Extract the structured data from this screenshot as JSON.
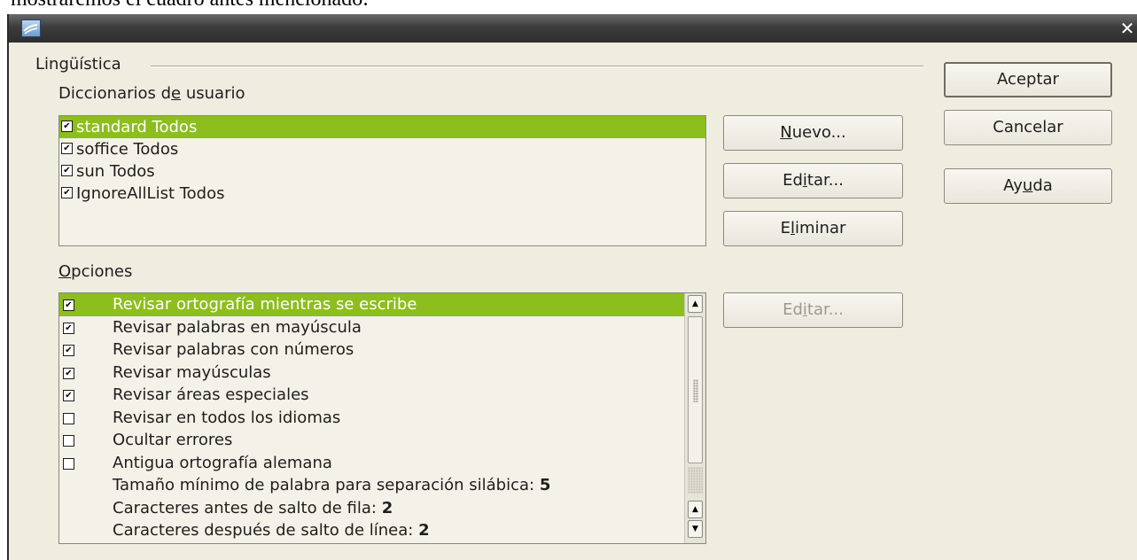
{
  "caption_above": "mostraremos el cuadro antes mencionado:",
  "window": {
    "title": ""
  },
  "section": {
    "title": "Lingüística"
  },
  "dictionaries": {
    "label": "Diccionarios de usuario",
    "items": [
      {
        "label": "standard Todos",
        "checked": true,
        "selected": true
      },
      {
        "label": "soffice Todos",
        "checked": true,
        "selected": false
      },
      {
        "label": "sun Todos",
        "checked": true,
        "selected": false
      },
      {
        "label": "IgnoreAllList Todos",
        "checked": true,
        "selected": false
      }
    ],
    "buttons": {
      "new": "Nuevo...",
      "edit": "Editar...",
      "delete": "Eliminar"
    }
  },
  "options": {
    "label": "Opciones",
    "edit_button": "Editar...",
    "items": [
      {
        "label": "Revisar ortografía mientras se escribe",
        "checked": true,
        "selected": true
      },
      {
        "label": "Revisar palabras en mayúscula",
        "checked": true
      },
      {
        "label": "Revisar palabras con números",
        "checked": true
      },
      {
        "label": "Revisar mayúsculas",
        "checked": true
      },
      {
        "label": "Revisar áreas especiales",
        "checked": true
      },
      {
        "label": "Revisar en todos los idiomas",
        "checked": false
      },
      {
        "label": "Ocultar errores",
        "checked": false
      },
      {
        "label": "Antigua ortografía alemana",
        "checked": false
      },
      {
        "label": "Tamaño mínimo de palabra para separación silábica:",
        "value": "5"
      },
      {
        "label": "Caracteres antes de salto de fila:",
        "value": "2"
      },
      {
        "label": "Caracteres después de salto de línea:",
        "value": "2"
      }
    ]
  },
  "dialog_buttons": {
    "ok": "Aceptar",
    "cancel": "Cancelar",
    "help": "Ayuda"
  },
  "colors": {
    "selection": "#8cbe1e",
    "dialog_bg": "#efece0",
    "titlebar": "#3c3c3c"
  }
}
